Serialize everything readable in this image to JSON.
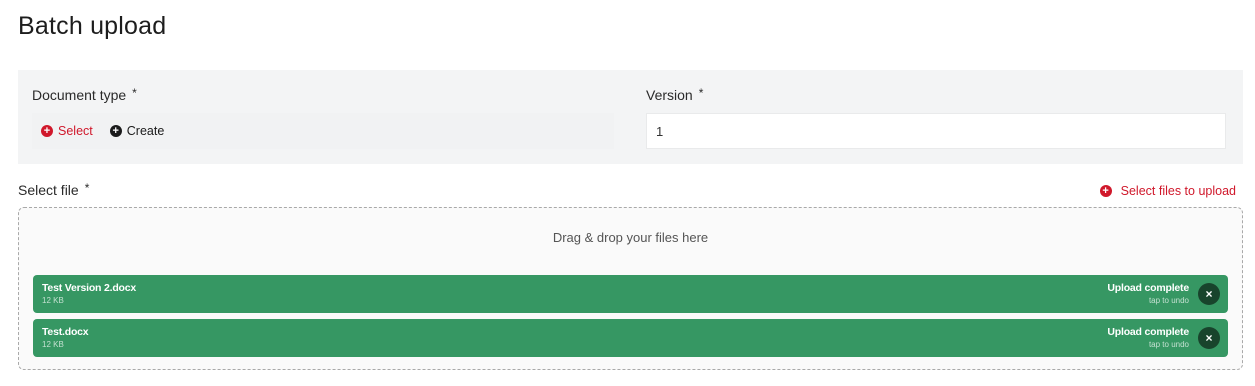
{
  "page": {
    "title": "Batch upload"
  },
  "form": {
    "document_type": {
      "label": "Document type",
      "required_marker": "*",
      "select_label": "Select",
      "create_label": "Create"
    },
    "version": {
      "label": "Version",
      "required_marker": "*",
      "value": "1"
    }
  },
  "select_file": {
    "label": "Select file",
    "required_marker": "*",
    "upload_link": "Select files to upload",
    "dropzone_text": "Drag & drop your files here",
    "files": [
      {
        "name": "Test Version 2.docx",
        "size": "12 KB",
        "status": "Upload complete",
        "hint": "tap to undo",
        "remove_icon": "×"
      },
      {
        "name": "Test.docx",
        "size": "12 KB",
        "status": "Upload complete",
        "hint": "tap to undo",
        "remove_icon": "×"
      }
    ]
  },
  "icons": {
    "plus": "+"
  },
  "colors": {
    "accent_red": "#d0182b",
    "success_green": "#369763",
    "panel_bg": "#f3f4f5"
  }
}
